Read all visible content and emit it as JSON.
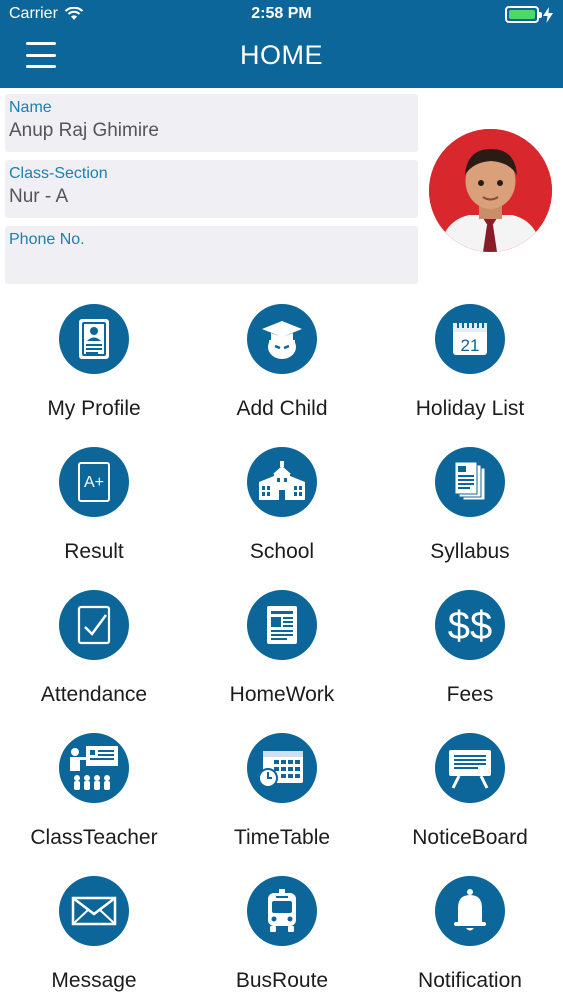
{
  "status_bar": {
    "carrier": "Carrier",
    "time": "2:58 PM"
  },
  "header": {
    "title": "HOME"
  },
  "profile": {
    "name_label": "Name",
    "name_value": "Anup Raj Ghimire",
    "class_label": "Class-Section",
    "class_value": "Nur - A",
    "phone_label": "Phone No.",
    "phone_value": ""
  },
  "menu": [
    {
      "label": "My Profile",
      "icon": "id-card-icon"
    },
    {
      "label": "Add Child",
      "icon": "graduate-icon"
    },
    {
      "label": "Holiday List",
      "icon": "calendar-icon",
      "icon_text": "21"
    },
    {
      "label": "Result",
      "icon": "grade-icon",
      "icon_text": "A+"
    },
    {
      "label": "School",
      "icon": "school-building-icon"
    },
    {
      "label": "Syllabus",
      "icon": "documents-icon"
    },
    {
      "label": "Attendance",
      "icon": "checkbox-icon"
    },
    {
      "label": "HomeWork",
      "icon": "notebook-icon"
    },
    {
      "label": "Fees",
      "icon": "dollar-icon",
      "icon_text": "$$"
    },
    {
      "label": "ClassTeacher",
      "icon": "teacher-icon"
    },
    {
      "label": "TimeTable",
      "icon": "timetable-icon"
    },
    {
      "label": "NoticeBoard",
      "icon": "notice-board-icon"
    },
    {
      "label": "Message",
      "icon": "envelope-icon"
    },
    {
      "label": "BusRoute",
      "icon": "bus-icon"
    },
    {
      "label": "Notification",
      "icon": "bell-icon"
    }
  ],
  "colors": {
    "header": "#0d6699",
    "accent_label": "#1a80b0",
    "field_bg": "#efeff4",
    "battery": "#4cd964"
  }
}
